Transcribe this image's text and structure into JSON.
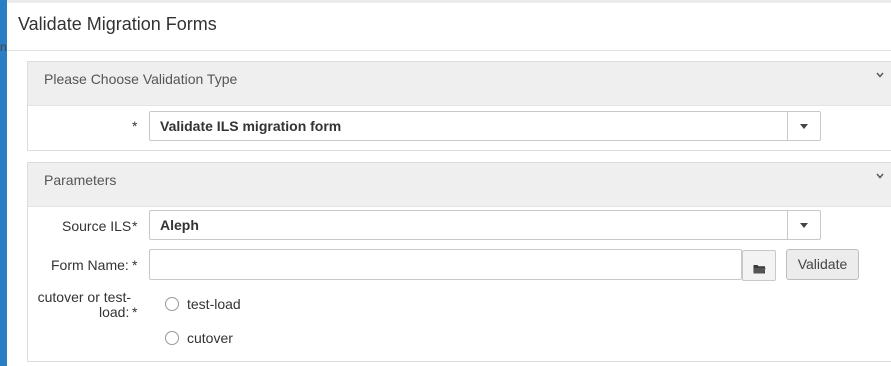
{
  "page": {
    "title": "Validate Migration Forms",
    "left_strip_letter": "n"
  },
  "validation_panel": {
    "title": "Please Choose Validation Type",
    "required_mark": "*",
    "validation_type": {
      "selected": "Validate ILS migration form"
    }
  },
  "parameters_panel": {
    "title": "Parameters",
    "source_ils": {
      "label": "Source ILS",
      "required_mark": "*",
      "selected": "Aleph"
    },
    "form_name": {
      "label": "Form Name:",
      "required_mark": "*",
      "value": "",
      "validate_label": "Validate"
    },
    "cutover": {
      "label_line1": "cutover or test-",
      "label_line2": "load:",
      "required_mark": "*",
      "options": [
        {
          "label": "test-load",
          "checked": false
        },
        {
          "label": "cutover",
          "checked": false
        }
      ]
    }
  },
  "icons": {
    "chevron": "chevron-down-icon",
    "caret": "caret-down-icon",
    "folder": "folder-icon"
  },
  "colors": {
    "left_strip": "#2a7fc4",
    "required": "#cc1f1f",
    "panel_header_bg": "#efefef"
  }
}
